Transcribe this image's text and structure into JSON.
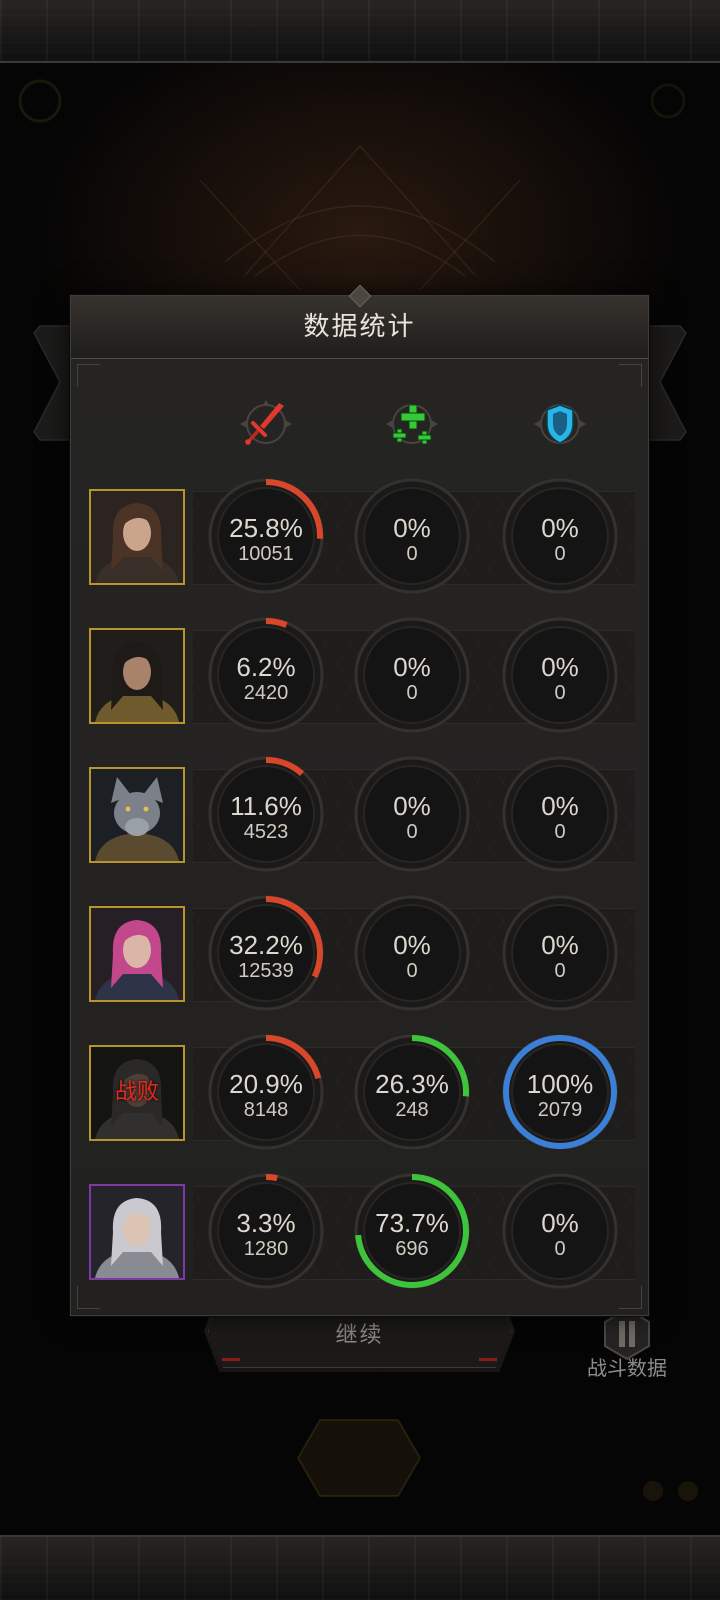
{
  "panel": {
    "title": "数据统计"
  },
  "columns": [
    {
      "icon": "sword-icon",
      "icon_color": "#e0392b",
      "arc_color": "#d9472b"
    },
    {
      "icon": "heal-plus-icon",
      "icon_color": "#35c93a",
      "arc_color": "#3ec43a"
    },
    {
      "icon": "shield-icon",
      "icon_color": "#29b6e6",
      "arc_color": "#3b80d6"
    }
  ],
  "rows": [
    {
      "frame_color": "#b8952a",
      "status": "",
      "stats": [
        {
          "percent": "25.8%",
          "value": "10051"
        },
        {
          "percent": "0%",
          "value": "0"
        },
        {
          "percent": "0%",
          "value": "0"
        }
      ]
    },
    {
      "frame_color": "#b8952a",
      "status": "",
      "stats": [
        {
          "percent": "6.2%",
          "value": "2420"
        },
        {
          "percent": "0%",
          "value": "0"
        },
        {
          "percent": "0%",
          "value": "0"
        }
      ]
    },
    {
      "frame_color": "#b8952a",
      "status": "",
      "stats": [
        {
          "percent": "11.6%",
          "value": "4523"
        },
        {
          "percent": "0%",
          "value": "0"
        },
        {
          "percent": "0%",
          "value": "0"
        }
      ]
    },
    {
      "frame_color": "#b8952a",
      "status": "",
      "stats": [
        {
          "percent": "32.2%",
          "value": "12539"
        },
        {
          "percent": "0%",
          "value": "0"
        },
        {
          "percent": "0%",
          "value": "0"
        }
      ]
    },
    {
      "frame_color": "#b8952a",
      "status": "战败",
      "stats": [
        {
          "percent": "20.9%",
          "value": "8148"
        },
        {
          "percent": "26.3%",
          "value": "248"
        },
        {
          "percent": "100%",
          "value": "2079"
        }
      ]
    },
    {
      "frame_color": "#7b3aa6",
      "status": "",
      "stats": [
        {
          "percent": "3.3%",
          "value": "1280"
        },
        {
          "percent": "73.7%",
          "value": "696"
        },
        {
          "percent": "0%",
          "value": "0"
        }
      ]
    }
  ],
  "footer": {
    "continue_label": "继续",
    "battle_data_label": "战斗数据"
  }
}
